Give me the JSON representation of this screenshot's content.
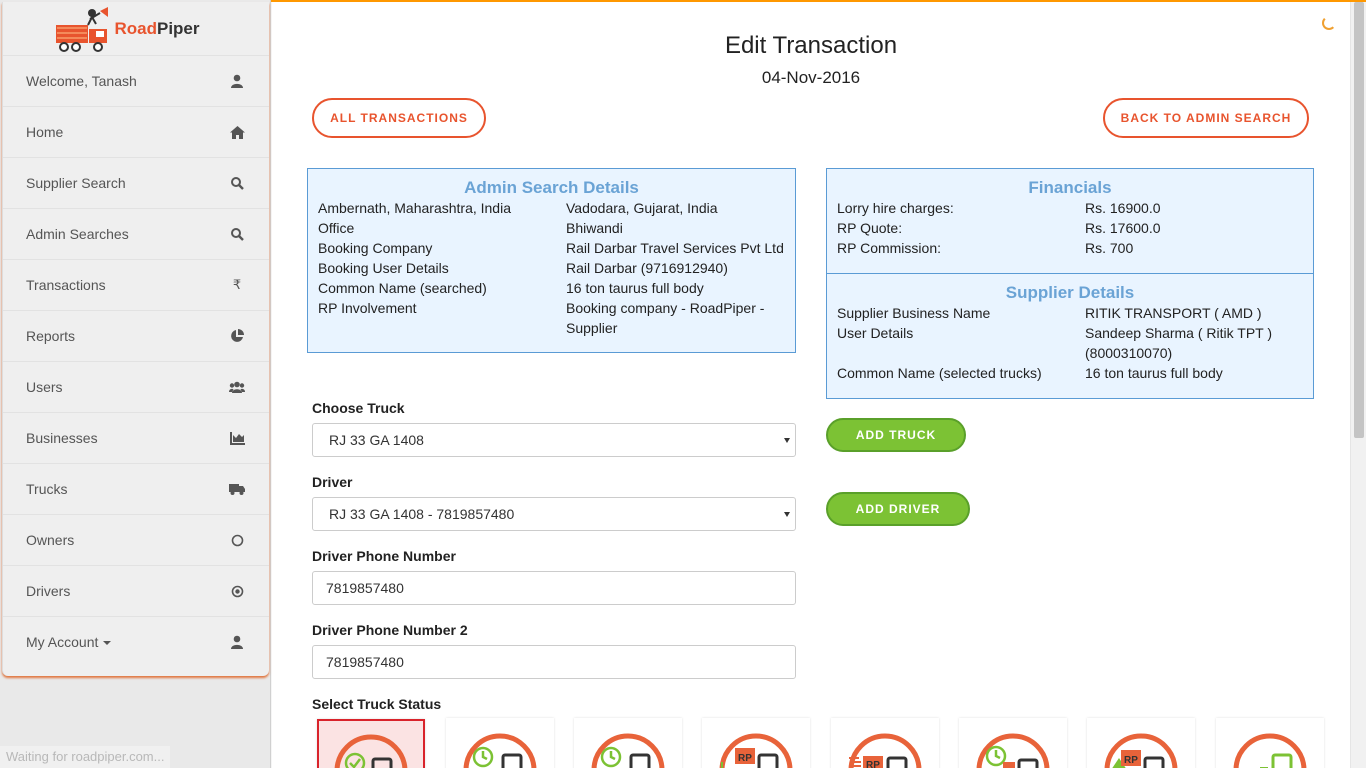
{
  "brand": {
    "name_part1": "Road",
    "name_part2": "Piper"
  },
  "sidebar": {
    "items": [
      {
        "label": "Welcome, Tanash",
        "icon": "user-icon"
      },
      {
        "label": "Home",
        "icon": "home-icon"
      },
      {
        "label": "Supplier Search",
        "icon": "search-icon"
      },
      {
        "label": "Admin Searches",
        "icon": "search-icon"
      },
      {
        "label": "Transactions",
        "icon": "rupee-icon"
      },
      {
        "label": "Reports",
        "icon": "pie-chart-icon"
      },
      {
        "label": "Users",
        "icon": "users-icon"
      },
      {
        "label": "Businesses",
        "icon": "bar-chart-icon"
      },
      {
        "label": "Trucks",
        "icon": "truck-icon"
      },
      {
        "label": "Owners",
        "icon": "circle-icon"
      },
      {
        "label": "Drivers",
        "icon": "dot-circle-icon"
      },
      {
        "label": "My Account",
        "icon": "user-icon"
      }
    ]
  },
  "status_bar": "Waiting for roadpiper.com...",
  "page": {
    "title": "Edit Transaction",
    "date": "04-Nov-2016"
  },
  "buttons": {
    "all_transactions": "ALL TRANSACTIONS",
    "back_to_admin_search": "BACK TO ADMIN SEARCH",
    "add_truck": "ADD TRUCK",
    "add_driver": "ADD DRIVER"
  },
  "admin_search": {
    "heading": "Admin Search Details",
    "rows": [
      {
        "left": "Ambernath, Maharashtra, India",
        "right": "Vadodara, Gujarat, India"
      },
      {
        "left": "Office",
        "right": "Bhiwandi"
      },
      {
        "left": "Booking Company",
        "right": "Rail Darbar Travel Services Pvt Ltd"
      },
      {
        "left": "Booking User Details",
        "right": "Rail Darbar (9716912940)"
      },
      {
        "left": "Common Name (searched)",
        "right": "16 ton taurus full body"
      },
      {
        "left": "RP Involvement",
        "right": "Booking company - RoadPiper - Supplier"
      }
    ]
  },
  "financials": {
    "heading": "Financials",
    "rows": [
      {
        "label": "Lorry hire charges:",
        "value": "Rs. 16900.0"
      },
      {
        "label": "RP Quote:",
        "value": "Rs. 17600.0"
      },
      {
        "label": "RP Commission:",
        "value": "Rs. 700"
      }
    ]
  },
  "supplier": {
    "heading": "Supplier Details",
    "rows": [
      {
        "label": "Supplier Business Name",
        "value": "RITIK TRANSPORT ( AMD )"
      },
      {
        "label": "User Details",
        "value": "Sandeep Sharma ( Ritik TPT ) (8000310070)"
      },
      {
        "label": "Common Name (selected trucks)",
        "value": "16 ton taurus full body"
      }
    ]
  },
  "form": {
    "choose_truck_label": "Choose Truck",
    "choose_truck_value": "RJ 33 GA 1408",
    "driver_label": "Driver",
    "driver_value": "RJ 33 GA 1408 - 7819857480",
    "phone_label": "Driver Phone Number",
    "phone_value": "7819857480",
    "phone2_label": "Driver Phone Number 2",
    "phone2_value": "7819857480",
    "status_label": "Select Truck Status"
  },
  "status_icons": [
    {
      "name": "confirmed-status-icon",
      "badge": "",
      "selected": true
    },
    {
      "name": "waiting-status-icon",
      "badge": "",
      "selected": false
    },
    {
      "name": "waiting-alt-status-icon",
      "badge": "",
      "selected": false
    },
    {
      "name": "rp-loading-status-icon",
      "badge": "RP",
      "selected": false
    },
    {
      "name": "rp-in-transit-status-icon",
      "badge": "RP",
      "selected": false
    },
    {
      "name": "delayed-status-icon",
      "badge": "",
      "selected": false
    },
    {
      "name": "rp-delivered-status-icon",
      "badge": "RP",
      "selected": false
    },
    {
      "name": "completed-status-icon",
      "badge": "",
      "selected": false
    }
  ],
  "colors": {
    "accent": "#e8542e",
    "panel_bg": "#e9f4ff",
    "panel_border": "#5a9bd5",
    "green": "#7cc234",
    "selected_border": "#d9232b"
  }
}
